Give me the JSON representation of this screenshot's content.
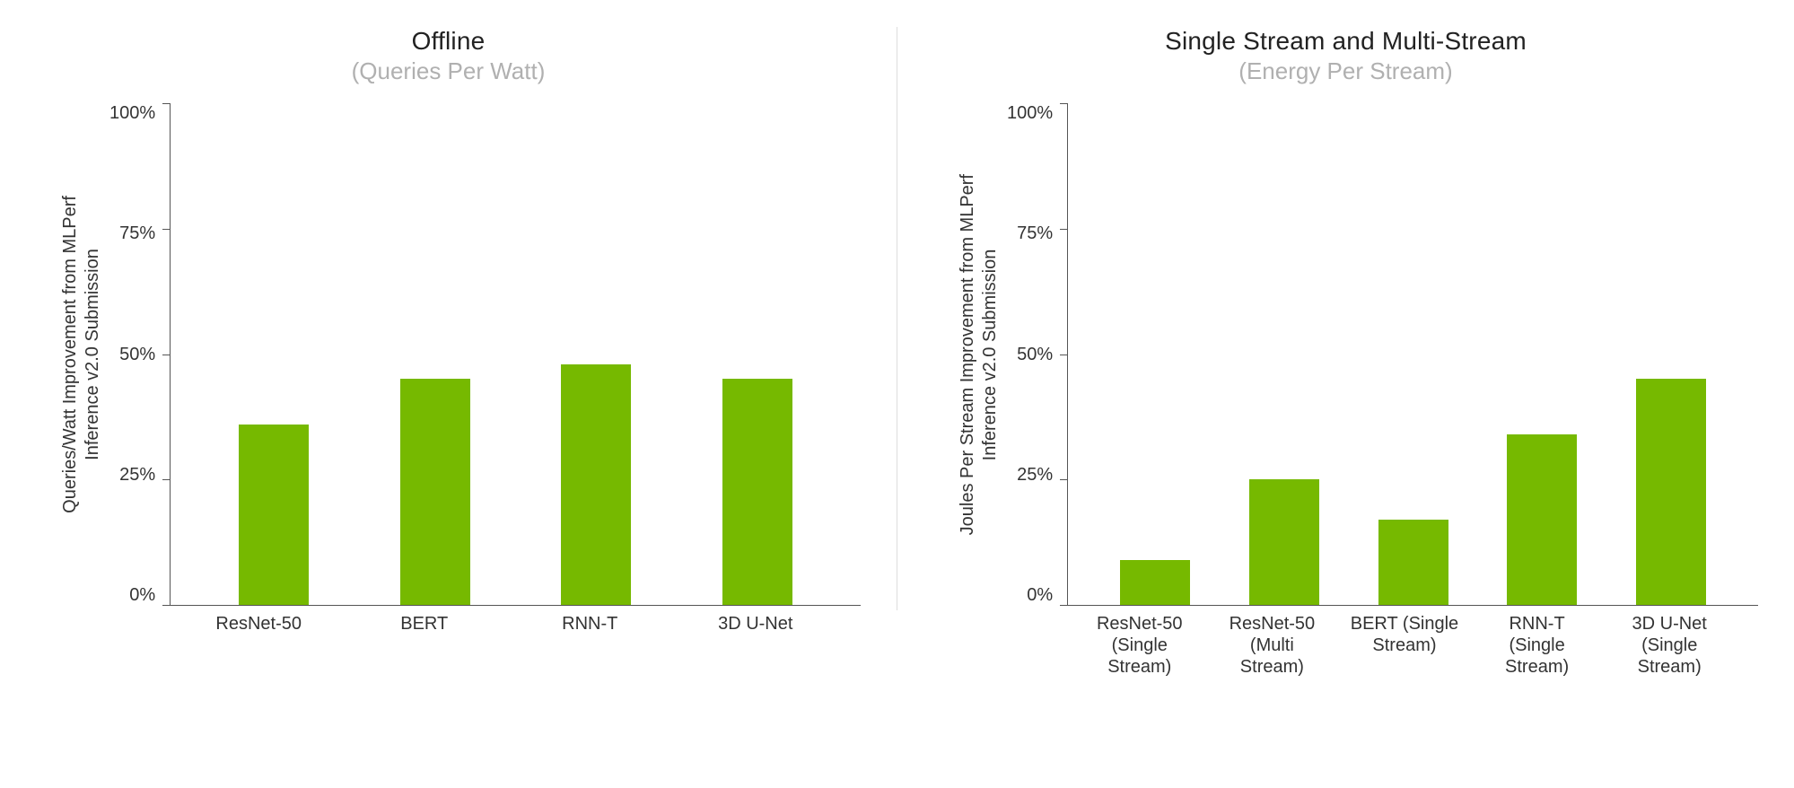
{
  "chart_data": [
    {
      "type": "bar",
      "title": "Offline",
      "subtitle": "(Queries Per Watt)",
      "ylabel": "Queries/Watt Improvement from MLPerf\nInference v2.0 Submission",
      "ylim": [
        0,
        100
      ],
      "ytick_labels": [
        "100%",
        "75%",
        "50%",
        "25%",
        "0%"
      ],
      "categories": [
        "ResNet-50",
        "BERT",
        "RNN-T",
        "3D U-Net"
      ],
      "values": [
        36,
        45,
        48,
        45
      ],
      "bar_color": "#76b900"
    },
    {
      "type": "bar",
      "title": "Single Stream and Multi-Stream",
      "subtitle": "(Energy Per Stream)",
      "ylabel": "Joules  Per Stream Improvement from MLPerf\nInference v2.0 Submission",
      "ylim": [
        0,
        100
      ],
      "ytick_labels": [
        "100%",
        "75%",
        "50%",
        "25%",
        "0%"
      ],
      "categories": [
        "ResNet-50\n(Single\nStream)",
        "ResNet-50\n(Multi\nStream)",
        "BERT (Single\nStream)",
        "RNN-T\n(Single\nStream)",
        "3D U-Net\n(Single\nStream)"
      ],
      "values": [
        9,
        25,
        17,
        34,
        45
      ],
      "bar_color": "#76b900"
    }
  ]
}
